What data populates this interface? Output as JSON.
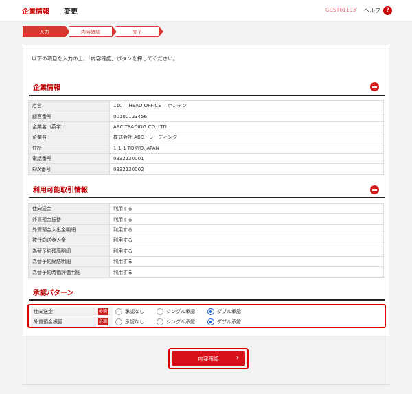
{
  "header": {
    "title": "企業情報",
    "subtitle": "変更",
    "screen_id": "GCST01103",
    "help_label": "ヘルプ",
    "help_icon": "?"
  },
  "steps": [
    {
      "label": "入力",
      "active": true
    },
    {
      "label": "内容確認",
      "active": false
    },
    {
      "label": "完了",
      "active": false
    }
  ],
  "instruction": "以下の項目を入力の上、「内容確認」ボタンを押してください。",
  "company_info": {
    "title": "企業情報",
    "rows": [
      {
        "label": "店名",
        "value": "110　 HEAD OFFICE　 ホンテン"
      },
      {
        "label": "顧客番号",
        "value": "00100123456"
      },
      {
        "label": "企業名（英字）",
        "value": "ABC TRADING CO.,LTD."
      },
      {
        "label": "企業名",
        "value": "株式会社 ABCトレーディング"
      },
      {
        "label": "住所",
        "value": "1-1-1 TOKYO,JAPAN"
      },
      {
        "label": "電話番号",
        "value": "0332120001"
      },
      {
        "label": "FAX番号",
        "value": "0332120002"
      }
    ]
  },
  "available_transactions": {
    "title": "利用可能取引情報",
    "rows": [
      {
        "label": "仕向送金",
        "value": "利用する"
      },
      {
        "label": "外貨預金振替",
        "value": "利用する"
      },
      {
        "label": "外貨預金入出金明細",
        "value": "利用する"
      },
      {
        "label": "被仕向送金入金",
        "value": "利用する"
      },
      {
        "label": "為替予約残高明細",
        "value": "利用する"
      },
      {
        "label": "為替予約締結明細",
        "value": "利用する"
      },
      {
        "label": "為替予約時価評価明細",
        "value": "利用する"
      }
    ]
  },
  "approval": {
    "title": "承認パターン",
    "required_label": "必須",
    "options": [
      "承認なし",
      "シングル承認",
      "ダブル承認"
    ],
    "rows": [
      {
        "label": "仕向送金",
        "selected": "ダブル承認"
      },
      {
        "label": "外貨預金振替",
        "selected": "ダブル承認"
      }
    ]
  },
  "confirm_button": {
    "label": "内容確認",
    "arrow": "›"
  },
  "colors": {
    "accent": "#cc0000",
    "radio_selected": "#1a5fd0"
  }
}
